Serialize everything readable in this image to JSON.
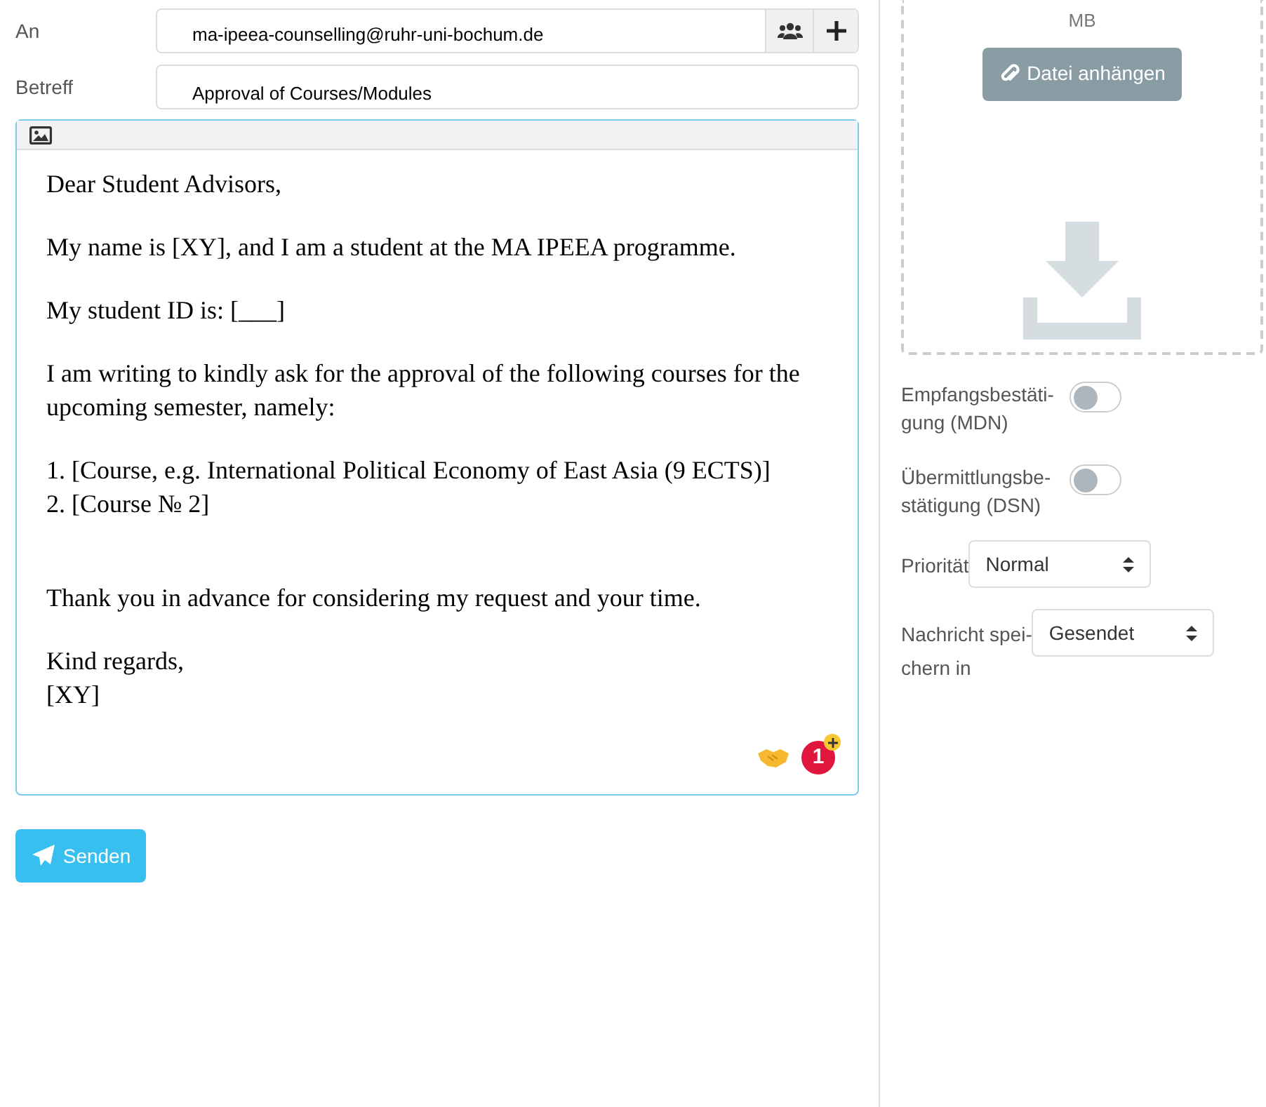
{
  "compose": {
    "to": {
      "label": "An",
      "value": "ma-ipeea-counselling@ruhr-uni-bochum.de"
    },
    "subject": {
      "label": "Betreff",
      "value": "Approval of Courses/Modules"
    },
    "body": [
      {
        "kind": "normal",
        "lines": [
          "Dear Student Advisors,"
        ]
      },
      {
        "kind": "normal",
        "lines": [
          "My name is [XY], and I am a student at the MA IPEEA programme."
        ]
      },
      {
        "kind": "normal",
        "lines": [
          "My student ID is: [___]"
        ]
      },
      {
        "kind": "normal",
        "lines": [
          "I am writing to kindly ask for the approval of the following courses for the upcoming semester, namely:"
        ]
      },
      {
        "kind": "normal",
        "lines": [
          "1. [Course, e.g. International Political Economy of East Asia (9 ECTS)]",
          "2. [Course № 2]"
        ]
      },
      {
        "kind": "spaced",
        "lines": [
          "Thank you in advance for considering my request and your time."
        ]
      },
      {
        "kind": "normal",
        "lines": [
          "Kind regards,",
          "[XY]"
        ]
      }
    ],
    "badge_count": "1",
    "send_button": "Senden"
  },
  "sidebar": {
    "size_unit": "MB",
    "attach_button": "Datei anhängen",
    "toggles": [
      {
        "label": "Empfangsbestäti-gung (MDN)",
        "on": false
      },
      {
        "label": "Übermittlungsbe-stätigung (DSN)",
        "on": false
      }
    ],
    "selects": [
      {
        "label": "Priorität",
        "value": "Normal"
      },
      {
        "label": "Nachricht spei-chern in",
        "value": "Gesendet"
      }
    ]
  }
}
